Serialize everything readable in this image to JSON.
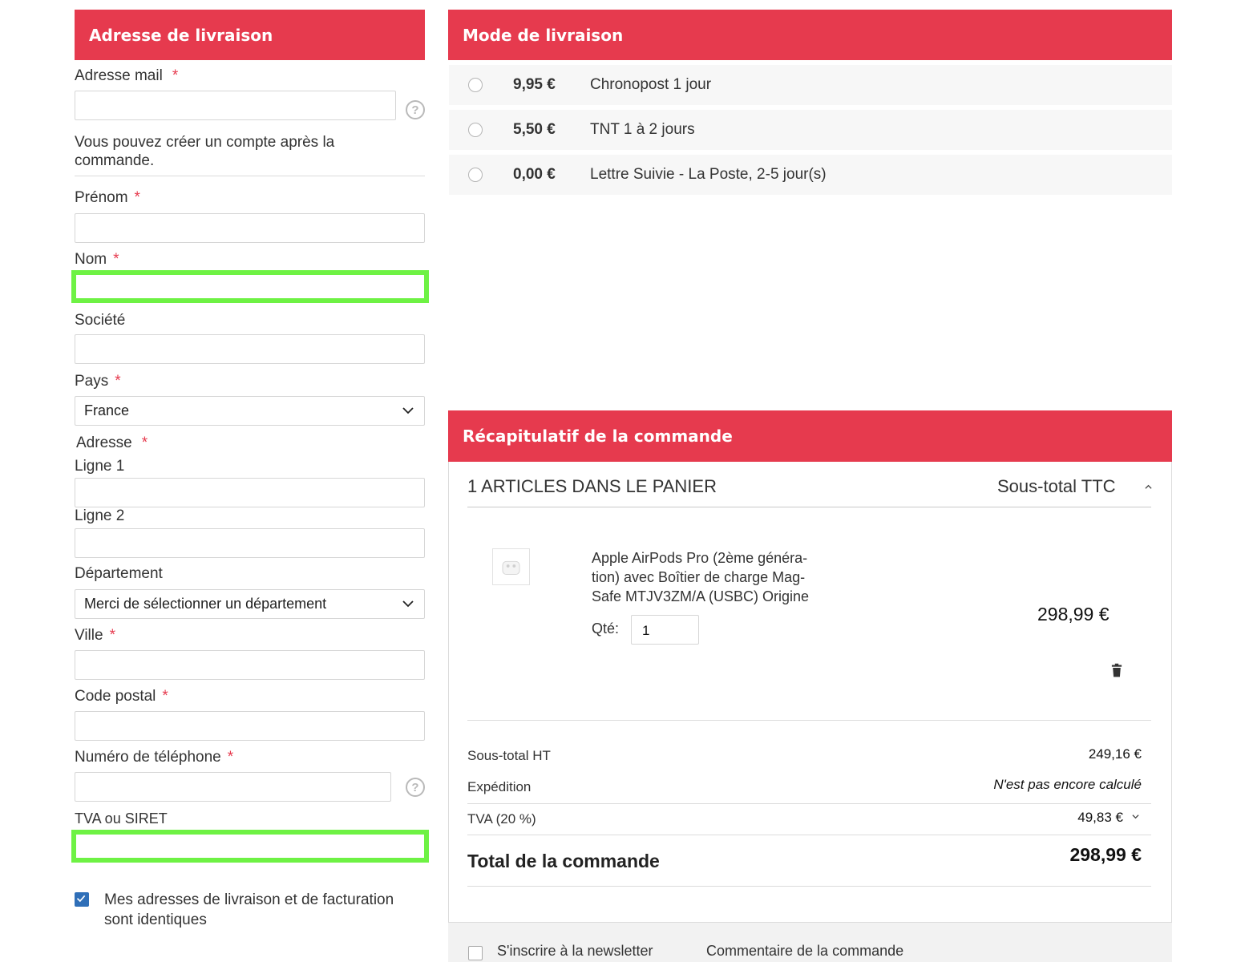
{
  "delivery_address": {
    "header": "Adresse de livraison",
    "required_mark": "*",
    "email_label": "Adresse mail",
    "account_info_line1": "Vous pouvez créer un compte après la",
    "account_info_line2": "commande.",
    "firstname_label": "Prénom",
    "lastname_label": "Nom",
    "company_label": "Société",
    "country_label": "Pays",
    "country_value": "France",
    "address_label": "Adresse",
    "line1_label": "Ligne 1",
    "line2_label": "Ligne 2",
    "department_label": "Département",
    "department_value": "Merci de sélectionner un département",
    "city_label": "Ville",
    "postcode_label": "Code postal",
    "phone_label": "Numéro de téléphone",
    "vat_label": "TVA ou SIRET",
    "same_address_line1": "Mes adresses de livraison et de facturation",
    "same_address_line2": "sont identiques",
    "same_address_checked": true,
    "help_glyph": "?"
  },
  "shipping": {
    "header": "Mode de livraison",
    "options": [
      {
        "price": "9,95 €",
        "name": "Chronopost 1 jour"
      },
      {
        "price": "5,50 €",
        "name": "TNT 1 à 2 jours"
      },
      {
        "price": "0,00 €",
        "name": "Lettre Suivie - La Poste, 2-5 jour(s)"
      }
    ]
  },
  "summary": {
    "header": "Récapitulatif de la commande",
    "items_count": "1 ARTICLES DANS LE PANIER",
    "subtotal_ttc_label": "Sous-total TTC",
    "product": {
      "name_line1": "Apple AirPods Pro (2ème généra-",
      "name_line2": "tion) avec Boîtier de charge Mag-",
      "name_line3": "Safe MTJV3ZM/A (USBC) Origine",
      "qty_label": "Qté:",
      "qty_value": "1",
      "price": "298,99 €"
    },
    "subtotal_ht_label": "Sous-total HT",
    "subtotal_ht_value": "249,16 €",
    "shipping_label": "Expédition",
    "shipping_value": "N'est pas encore calculé",
    "vat_label": "TVA (20 %)",
    "vat_value": "49,83 €",
    "total_label": "Total de la commande",
    "total_value": "298,99 €"
  },
  "footer": {
    "newsletter_label": "S'inscrire à la newsletter",
    "comment_label": "Commentaire de la commande"
  },
  "colors": {
    "accent": "#e63a4e",
    "highlight": "#6ef244",
    "checkbox": "#2f6fb8"
  }
}
